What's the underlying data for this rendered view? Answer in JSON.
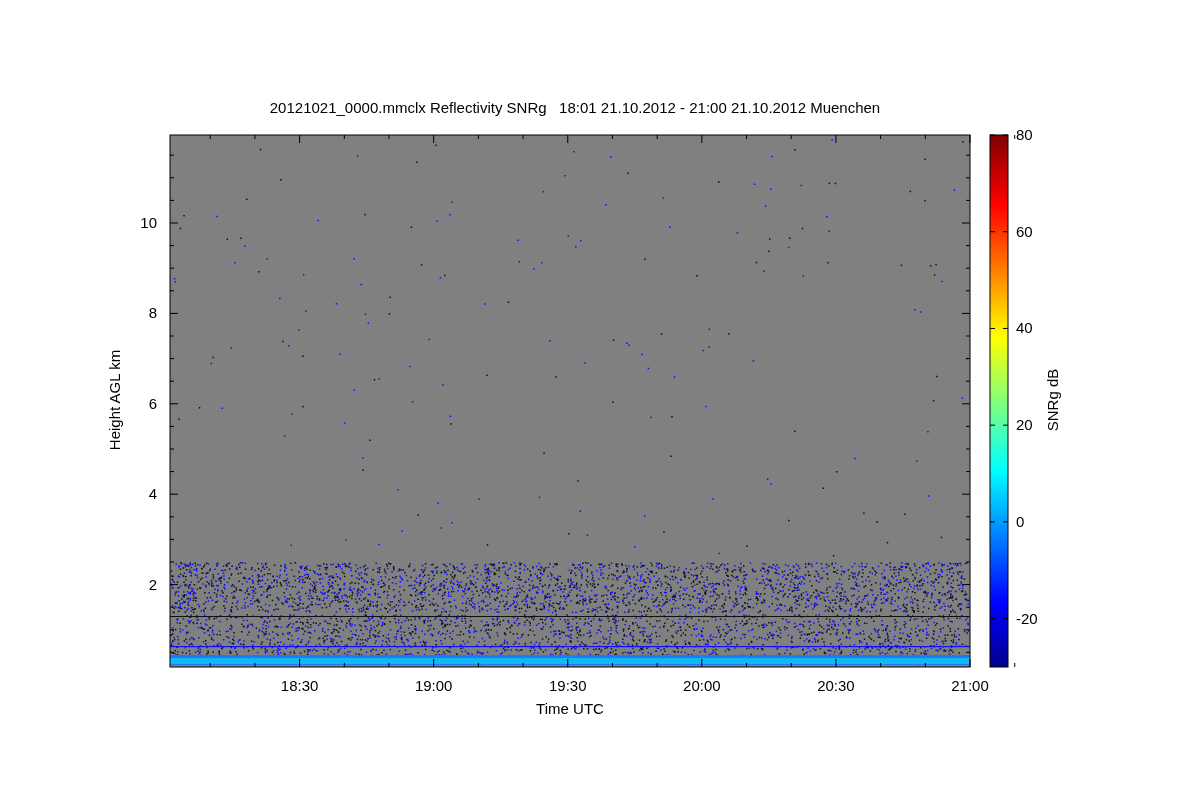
{
  "figure": {
    "title": "20121021_0000.mmclx Reflectivity SNRg   18:01 21.10.2012 - 21:00 21.10.2012 Muenchen",
    "plot": {
      "xlabel": "Time UTC",
      "ylabel": "Height AGL km",
      "xticks": [
        "18:30",
        "19:00",
        "19:30",
        "20:00",
        "20:30",
        "21:00"
      ],
      "yticks": [
        "10",
        "8",
        "6",
        "4",
        "2"
      ]
    },
    "colorbar": {
      "label": "SNRg dB",
      "ticks": [
        "80",
        "60",
        "40",
        "20",
        "0",
        "-20"
      ]
    }
  }
}
